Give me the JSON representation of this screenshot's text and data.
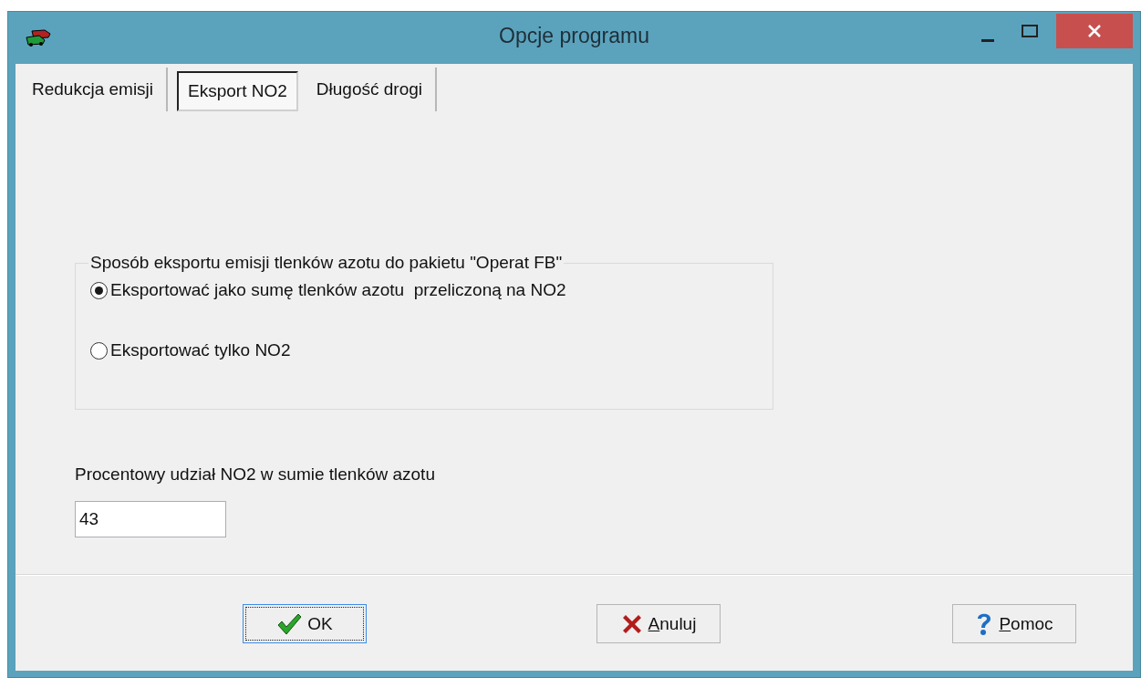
{
  "window": {
    "title": "Opcje programu"
  },
  "tabs": [
    {
      "label": "Redukcja emisji",
      "selected": false
    },
    {
      "label": "Eksport NO2",
      "selected": true
    },
    {
      "label": "Długość drogi",
      "selected": false
    }
  ],
  "export_group": {
    "legend": "Sposób eksportu emisji tlenków azotu do pakietu \"Operat FB\"",
    "options": [
      {
        "label": "Eksportować jako sumę tlenków azotu  przeliczoną na NO2",
        "selected": true
      },
      {
        "label": "Eksportować tylko NO2",
        "selected": false
      }
    ]
  },
  "share_field": {
    "label": "Procentowy udział NO2 w sumie tlenków azotu",
    "value": "43"
  },
  "buttons": [
    {
      "kind": "ok",
      "label": "OK",
      "underline_first": false,
      "focused": true
    },
    {
      "kind": "cancel",
      "label": "Anuluj",
      "underline_first": true,
      "focused": false
    },
    {
      "kind": "help",
      "label": "Pomoc",
      "underline_first": true,
      "focused": false
    }
  ]
}
